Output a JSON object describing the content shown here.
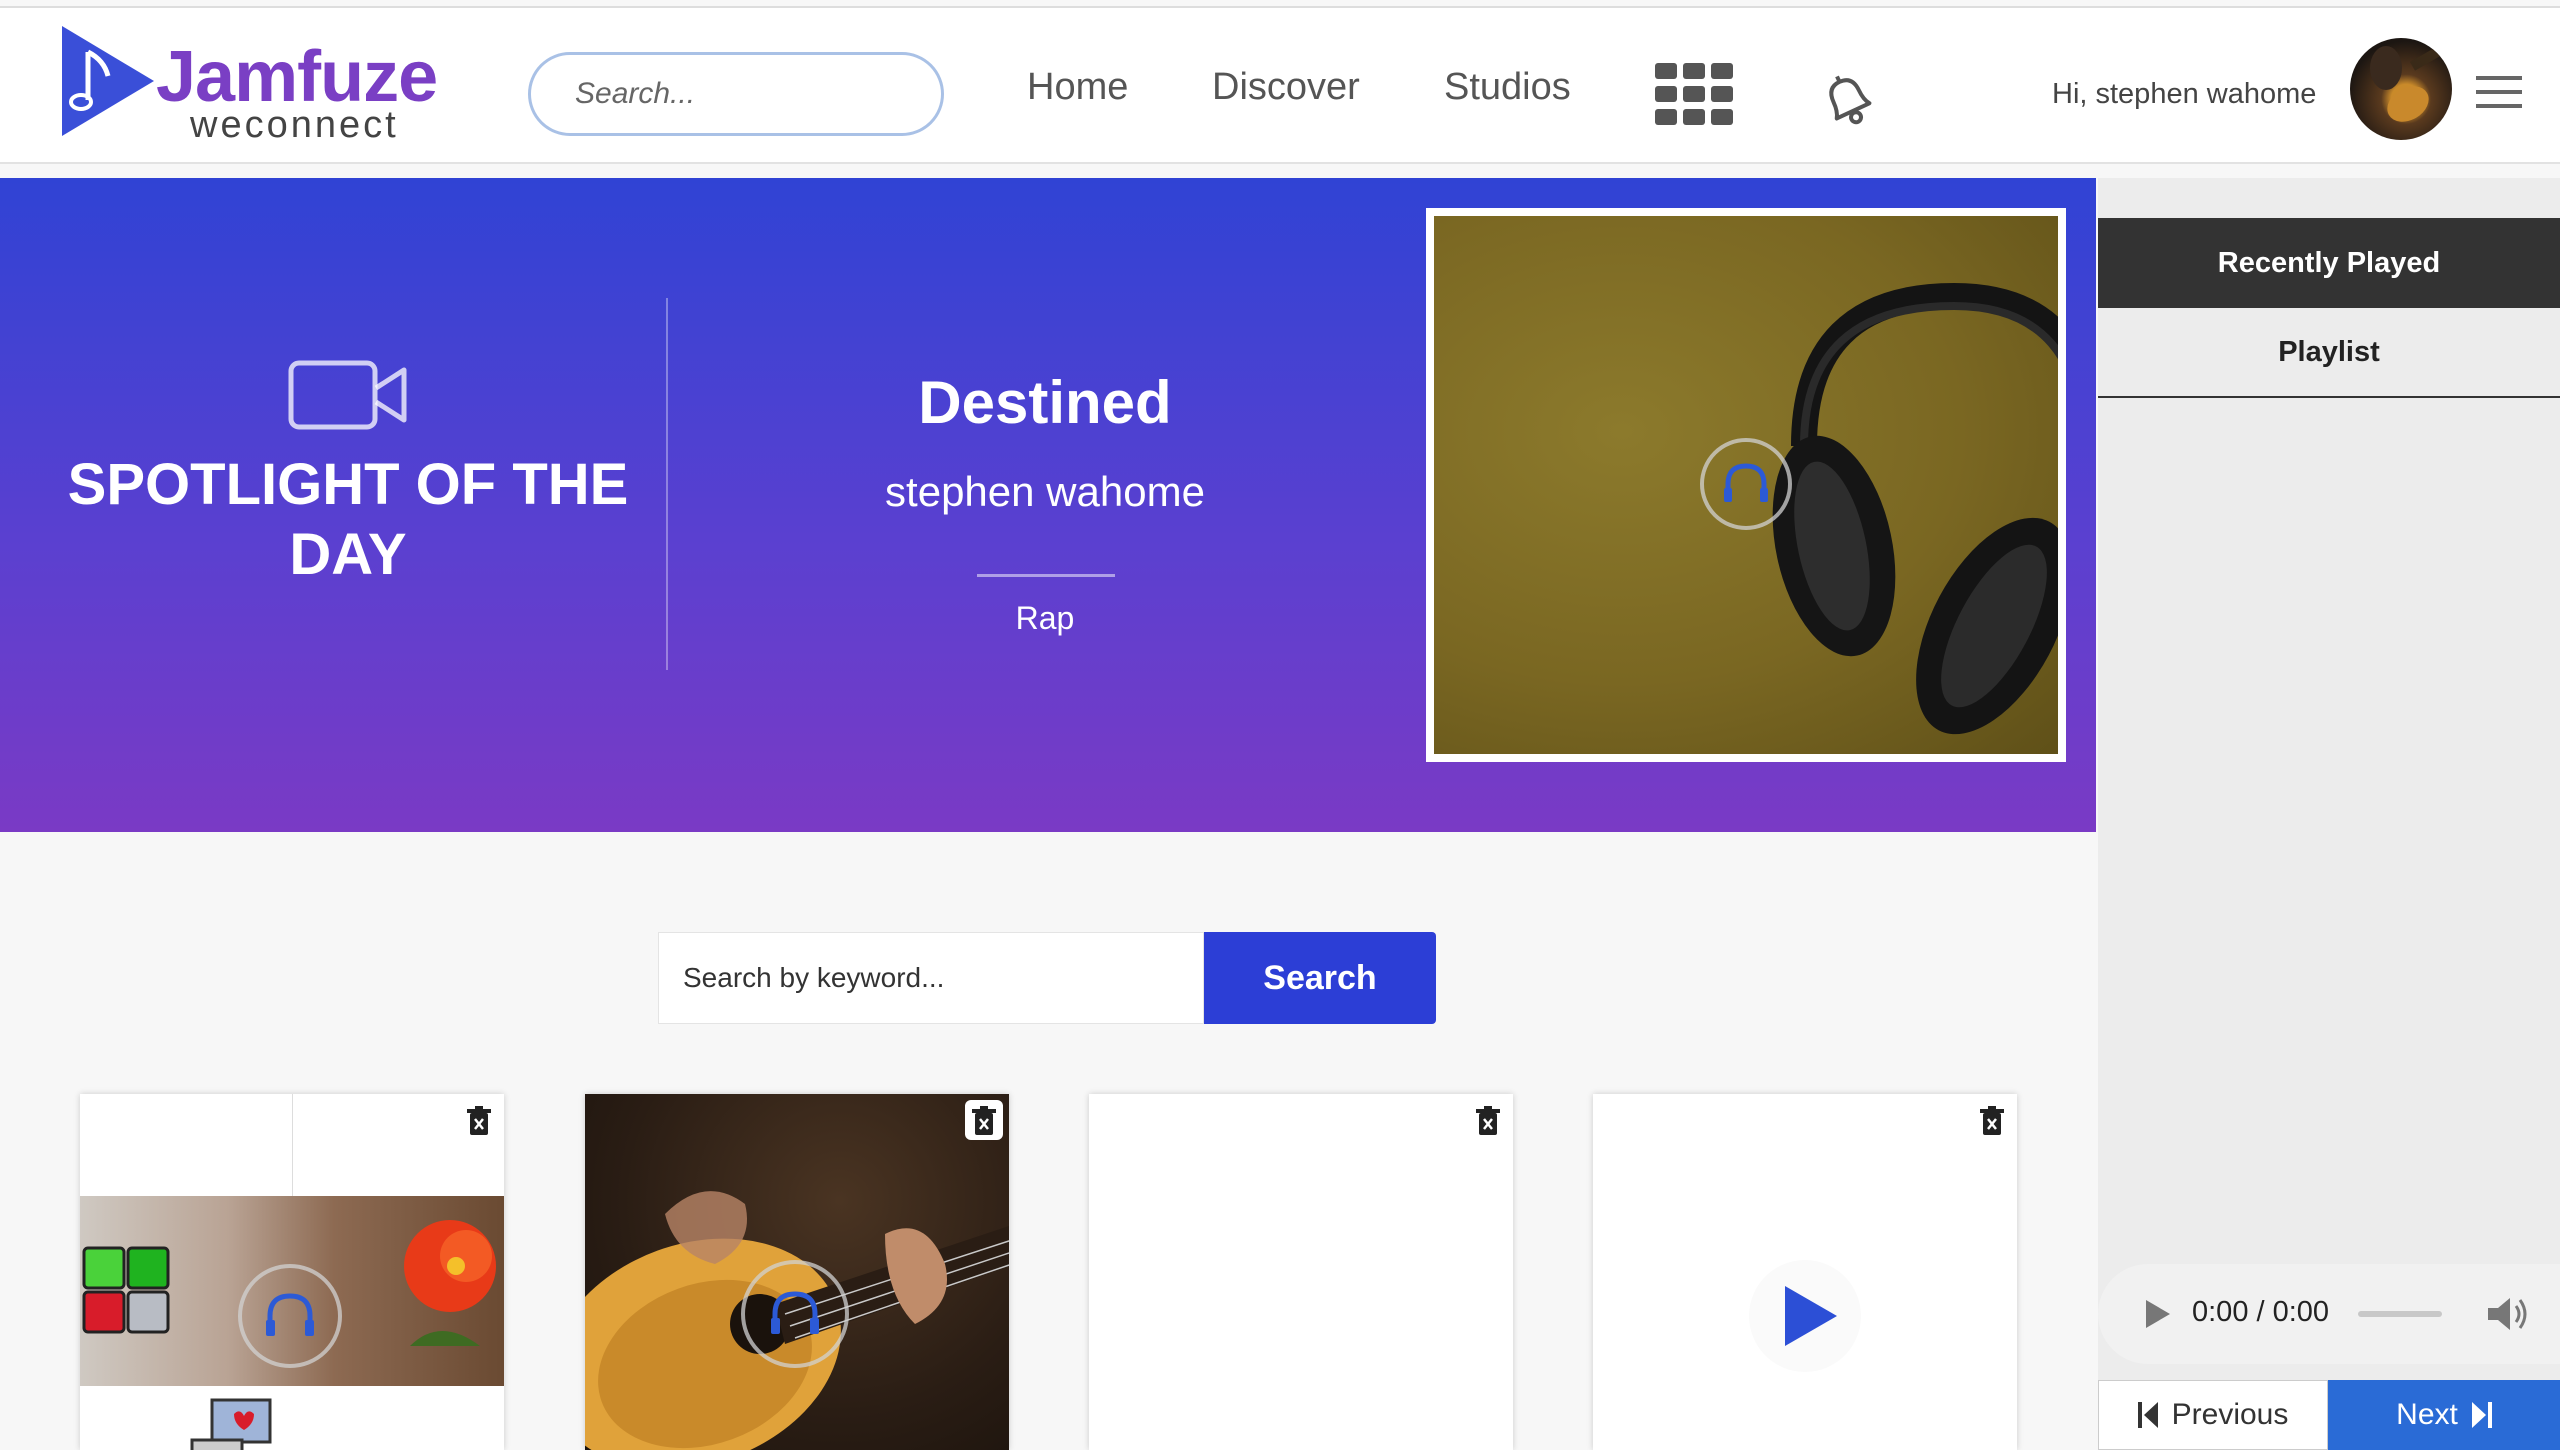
{
  "brand": {
    "name": "Jamfuze",
    "tagline": "weconnect",
    "logo_color": "#3a4fd8",
    "title_color": "#7a3fc4"
  },
  "header": {
    "search_placeholder": "Search...",
    "nav": [
      "Home",
      "Discover",
      "Studios"
    ],
    "apps_icon": "grid-icon",
    "notifications_icon": "bell-icon",
    "greeting": "Hi, stephen wahome",
    "menu_icon": "hamburger-icon"
  },
  "hero": {
    "spotlight_label": "SPOTLIGHT OF THE DAY",
    "spotlight_icon": "video-camera-icon",
    "song_title": "Destined",
    "artist": "stephen wahome",
    "genre": "Rap",
    "gradient_top": "#3043d4",
    "gradient_bottom": "#7a3ac5"
  },
  "search": {
    "placeholder": "Search by keyword...",
    "button_label": "Search",
    "button_color": "#2c3ed6"
  },
  "cards": [
    {
      "delete_icon": "trash-icon",
      "overlay_icon": "headphones-icon"
    },
    {
      "delete_icon": "trash-icon",
      "overlay_icon": "headphones-icon"
    },
    {
      "delete_icon": "trash-icon"
    },
    {
      "delete_icon": "trash-icon",
      "overlay_icon": "play-icon"
    }
  ],
  "sidebar": {
    "tabs": [
      "Recently Played",
      "Playlist"
    ],
    "active_tab": "Recently Played",
    "player": {
      "time": "0:00 / 0:00",
      "play_icon": "play-icon",
      "volume_icon": "volume-icon"
    },
    "previous_label": "Previous",
    "next_label": "Next",
    "next_color": "#2a6bd6"
  }
}
